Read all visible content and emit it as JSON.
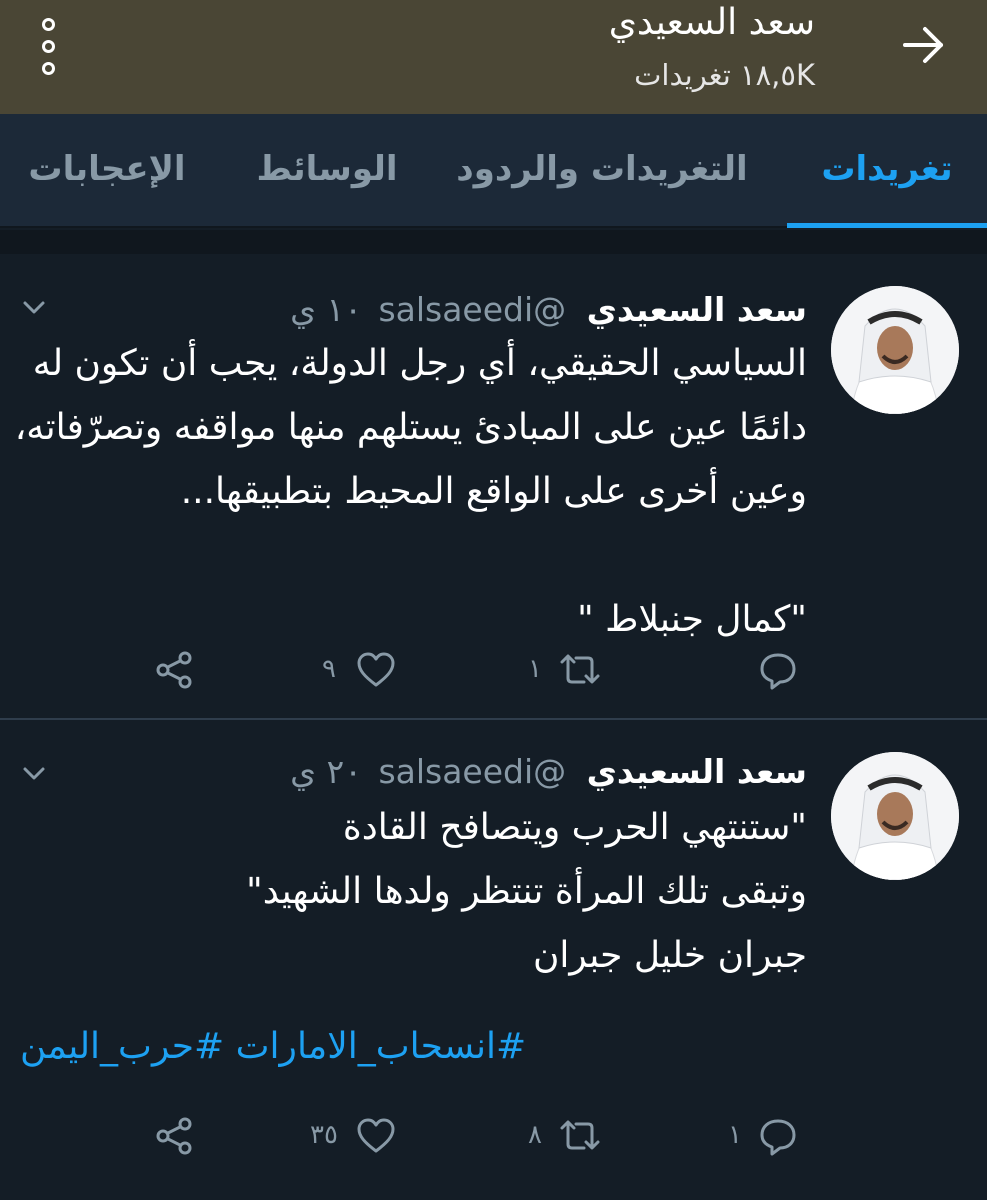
{
  "header": {
    "title": "سعد السعيدي",
    "tweet_count": "١٨,٥K تغريدات"
  },
  "tabs": [
    {
      "label": "تغريدات",
      "active": true
    },
    {
      "label": "التغريدات والردود",
      "active": false
    },
    {
      "label": "الوسائط",
      "active": false
    },
    {
      "label": "الإعجابات",
      "active": false
    }
  ],
  "tweets": [
    {
      "name": "سعد السعيدي",
      "handle": "@salsaeedi",
      "time": "١٠ ي",
      "text": "السياسي الحقيقي، أي رجل الدولة، يجب أن تكون له\nدائمًا عين على المبادئ يستلهم منها مواقفه وتصرّفاته،\nوعين أخرى على الواقع المحيط بتطبيقها...\n\n\"كمال جنبلاط \"",
      "replies": "",
      "retweets": "١",
      "likes": "٩"
    },
    {
      "name": "سعد السعيدي",
      "handle": "@salsaeedi",
      "time": "٢٠ ي",
      "text": "\"ستنتهي الحرب ويتصافح القادة\nوتبقى تلك المرأة تنتظر ولدها الشهيد\"\nجبران خليل جبران  ",
      "hashtags": "#انسحاب_الامارات #حرب_اليمن",
      "replies": "١",
      "retweets": "٨",
      "likes": "٣٥"
    }
  ],
  "colors": {
    "header_bg": "#4a4635",
    "tab_bar_bg": "#1c2938",
    "page_bg": "#141d26",
    "accent": "#1da1f2",
    "muted": "#8899a6"
  },
  "icons": [
    "more-vertical-icon",
    "back-arrow-icon",
    "dropdown-caret-icon",
    "reply-icon",
    "retweet-icon",
    "like-icon",
    "share-icon"
  ]
}
